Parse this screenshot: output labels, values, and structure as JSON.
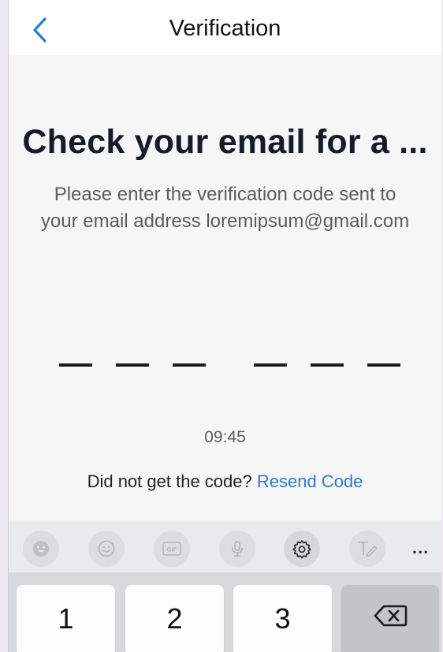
{
  "header": {
    "title": "Verification",
    "back_icon": "chevron-left-icon",
    "accent": "#2d79d6"
  },
  "main": {
    "headline": "Check your email for a ...",
    "subtitle_line1": "Please enter the verification code sent to",
    "subtitle_line2": "your email address loremipsum@gmail.com",
    "code_length": 6,
    "timer": "09:45",
    "resend_prompt": "Did not get the code?",
    "resend_link": "Resend Code"
  },
  "keyboard_toolbar": {
    "items": [
      "emoji-icon",
      "sticker-icon",
      "gif-icon",
      "microphone-icon",
      "settings-icon",
      "handwriting-icon",
      "more-icon"
    ],
    "more_label": "..."
  },
  "keyboard": {
    "keys": [
      "1",
      "2",
      "3"
    ],
    "backspace_icon": "backspace-icon"
  }
}
